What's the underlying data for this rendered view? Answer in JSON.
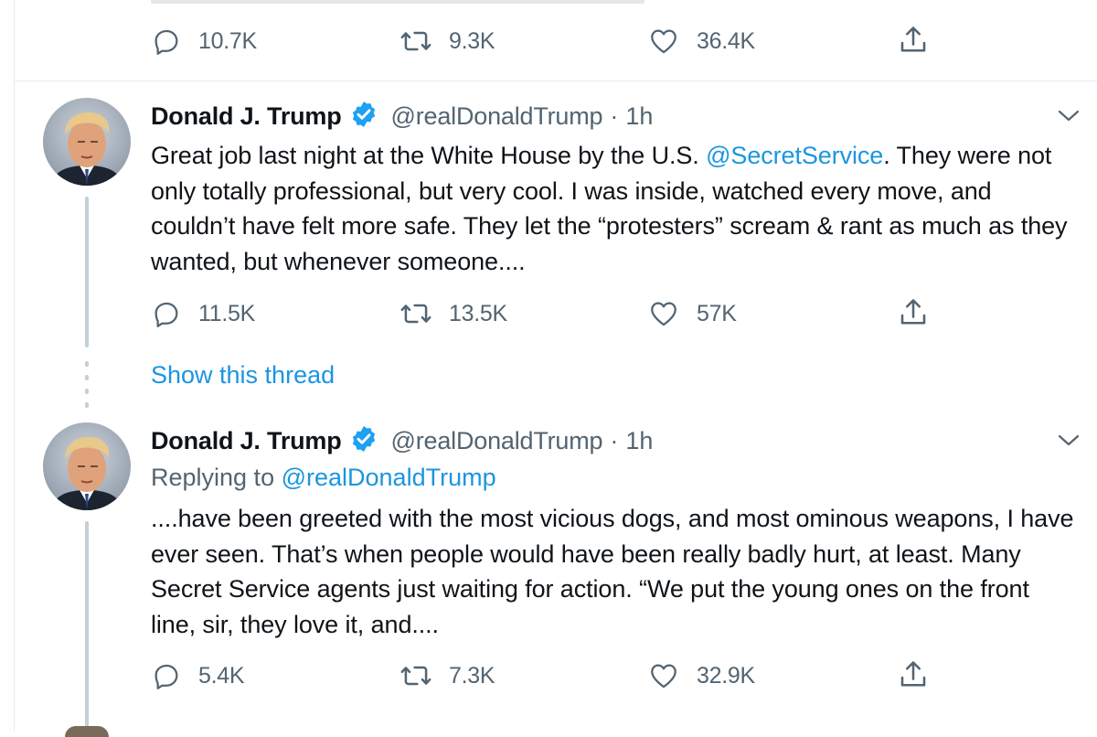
{
  "top_tweet": {
    "actions": {
      "replies": "10.7K",
      "retweets": "9.3K",
      "likes": "36.4K"
    }
  },
  "tweet1": {
    "author_name": "Donald J. Trump",
    "handle": "@realDonaldTrump",
    "separator": "·",
    "time": "1h",
    "text_before": "Great job last night at the White House by the U.S. ",
    "mention": "@SecretService",
    "text_after": ". They were not only totally professional, but very cool. I was inside, watched every move, and couldn’t have felt more safe. They let the “protesters” scream & rant as much as they wanted, but whenever someone....",
    "actions": {
      "replies": "11.5K",
      "retweets": "13.5K",
      "likes": "57K"
    },
    "show_thread": "Show this thread"
  },
  "tweet2": {
    "author_name": "Donald J. Trump",
    "handle": "@realDonaldTrump",
    "separator": "·",
    "time": "1h",
    "replying_prefix": "Replying to ",
    "replying_handle": "@realDonaldTrump",
    "text": "....have been greeted with the most vicious dogs, and most ominous weapons, I have ever seen. That’s when people would have been really badly hurt, at least. Many Secret Service agents just waiting for action. “We put the young ones on the front line, sir, they love it, and....",
    "actions": {
      "replies": "5.4K",
      "retweets": "7.3K",
      "likes": "32.9K"
    }
  },
  "colors": {
    "accent": "#1b95e0",
    "verified": "#1da1f2",
    "secondary_text": "#536471",
    "divider": "#e6ecf0"
  },
  "icons": [
    "reply-icon",
    "retweet-icon",
    "like-icon",
    "share-icon",
    "verified-badge-icon",
    "chevron-down-icon"
  ]
}
